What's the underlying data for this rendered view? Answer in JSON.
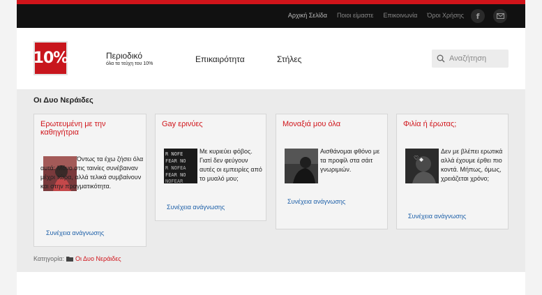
{
  "topbar": {
    "links": [
      "Αρχική Σελίδα",
      "Ποιοι είμαστε",
      "Επικοινωνία",
      "Όροι Χρήσης"
    ],
    "active_index": 0
  },
  "header": {
    "logo_text": "10%",
    "nav": [
      {
        "label": "Περιοδικό",
        "sub": "όλα τα τεύχη του 10%"
      },
      {
        "label": "Επικαιρότητα"
      },
      {
        "label": "Στήλες"
      }
    ],
    "search_placeholder": "Αναζήτηση"
  },
  "main": {
    "section_title": "Οι Δυο Νεράιδες",
    "cards": [
      {
        "title": "Ερωτευμένη με την καθηγήτρια",
        "excerpt": "Όντως τα έχω ζήσει όλα αυτά: Μόνο στις ταινίες συνέβαιναν μέχρι τώρα, αλλά τελικά συμβαίνουν και στην πραγματικότητα.",
        "more": "Συνέχεια ανάγνωσης"
      },
      {
        "title": "Gay ερινύες",
        "excerpt": "Με κυριεύει φόβος. Γιατί δεν φεύγουν αυτές οι εμπειρίες από το μυαλό μου;",
        "more": "Συνέχεια ανάγνωσης"
      },
      {
        "title": "Μοναξιά μου όλα",
        "excerpt": "Αισθάνομαι φθόνο με τα προφίλ στα σάιτ γνωριμιών.",
        "more": "Συνέχεια ανάγνωσης"
      },
      {
        "title": "Φιλία ή έρωτας;",
        "excerpt": "Δεν με βλέπει ερωτικά αλλά έχουμε έρθει πιο κοντά. Μήπως, όμως, χρειάζεται χρόνο;",
        "more": "Συνέχεια ανάγνωσης"
      }
    ],
    "category_label": "Κατηγορία:",
    "category_link": "Οι Δυο Νεράιδες"
  },
  "colors": {
    "accent": "#d0141a",
    "link": "#1c5fa8",
    "topbar": "#111111"
  }
}
